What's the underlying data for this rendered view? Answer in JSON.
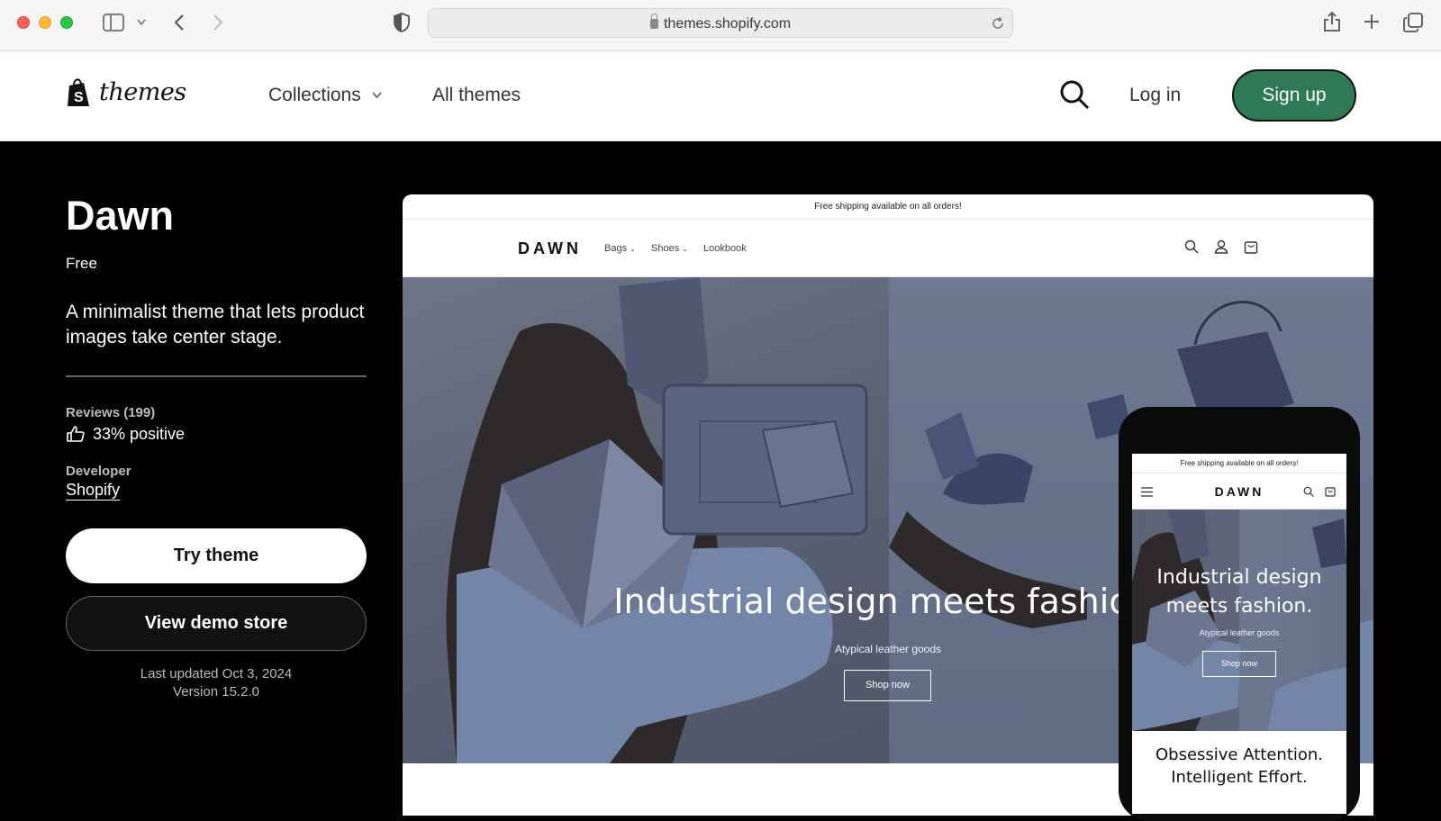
{
  "browser": {
    "url": "themes.shopify.com"
  },
  "header": {
    "logo_text": "themes",
    "nav": [
      {
        "label": "Collections"
      },
      {
        "label": "All themes"
      }
    ],
    "login_label": "Log in",
    "signup_label": "Sign up",
    "colors": {
      "signup_bg": "#2d7a55"
    }
  },
  "theme": {
    "name": "Dawn",
    "price": "Free",
    "description": "A minimalist theme that lets product images take center stage.",
    "reviews_label": "Reviews (199)",
    "reviews_positive": "33% positive",
    "developer_label": "Developer",
    "developer_name": "Shopify",
    "try_label": "Try theme",
    "demo_label": "View demo store",
    "last_updated": "Last updated Oct 3, 2024",
    "version": "Version 15.2.0"
  },
  "preview": {
    "announcement": "Free shipping available on all orders!",
    "store_logo": "DAWN",
    "nav": [
      {
        "label": "Bags"
      },
      {
        "label": "Shoes"
      },
      {
        "label": "Lookbook"
      }
    ],
    "hero_headline": "Industrial design meets fashion.",
    "hero_sub": "Atypical leather goods",
    "hero_button": "Shop now"
  },
  "mobile_preview": {
    "announcement": "Free shipping available on all orders!",
    "store_logo": "DAWN",
    "hero_headline": "Industrial design meets fashion.",
    "hero_sub": "Atypical leather goods",
    "hero_button": "Shop now",
    "section_heading": "Obsessive Attention. Intelligent Effort."
  }
}
